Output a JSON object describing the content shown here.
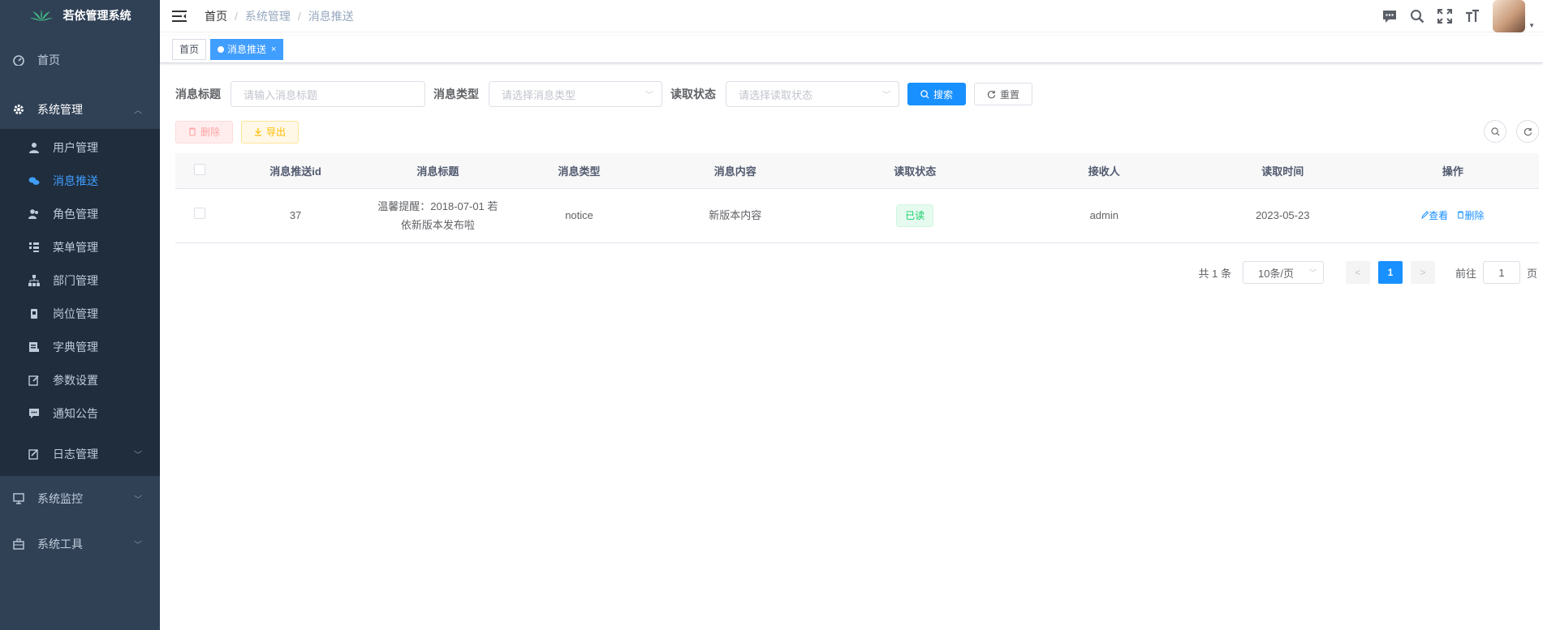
{
  "app": {
    "title": "若依管理系统"
  },
  "sidebar": {
    "home": "首页",
    "system": "系统管理",
    "system_items": [
      {
        "label": "用户管理",
        "icon": "user-icon"
      },
      {
        "label": "消息推送",
        "icon": "chat-icon",
        "active": true
      },
      {
        "label": "角色管理",
        "icon": "peoples-icon"
      },
      {
        "label": "菜单管理",
        "icon": "tree-table-icon"
      },
      {
        "label": "部门管理",
        "icon": "tree-icon"
      },
      {
        "label": "岗位管理",
        "icon": "post-icon"
      },
      {
        "label": "字典管理",
        "icon": "dict-icon"
      },
      {
        "label": "参数设置",
        "icon": "edit-icon"
      },
      {
        "label": "通知公告",
        "icon": "message-icon"
      },
      {
        "label": "日志管理",
        "icon": "log-icon"
      }
    ],
    "monitor": "系统监控",
    "tool": "系统工具"
  },
  "breadcrumb": {
    "b1": "首页",
    "b2": "系统管理",
    "b3": "消息推送"
  },
  "tags": {
    "home": "首页",
    "current": "消息推送",
    "close": "×"
  },
  "search": {
    "title_label": "消息标题",
    "title_placeholder": "请输入消息标题",
    "type_label": "消息类型",
    "type_placeholder": "请选择消息类型",
    "status_label": "读取状态",
    "status_placeholder": "请选择读取状态",
    "search_btn": "搜索",
    "reset_btn": "重置"
  },
  "toolbar": {
    "delete": "删除",
    "export": "导出"
  },
  "table": {
    "headers": [
      "消息推送id",
      "消息标题",
      "消息类型",
      "消息内容",
      "读取状态",
      "接收人",
      "读取时间",
      "操作"
    ],
    "rows": [
      {
        "id": "37",
        "title_line1": "温馨提醒：2018-07-01 若",
        "title_line2": "依新版本发布啦",
        "type": "notice",
        "content": "新版本内容",
        "status": "已读",
        "receiver": "admin",
        "read_time": "2023-05-23",
        "op_view": "查看",
        "op_delete": "删除"
      }
    ]
  },
  "pagination": {
    "total": "共 1 条",
    "page_size": "10条/页",
    "current_page": "1",
    "goto_prefix": "前往",
    "goto_value": "1",
    "goto_suffix": "页"
  },
  "colors": {
    "sidebar_bg": "#304156",
    "submenu_bg": "#1f2d3d",
    "primary": "#1890ff",
    "success": "#13ce66"
  }
}
